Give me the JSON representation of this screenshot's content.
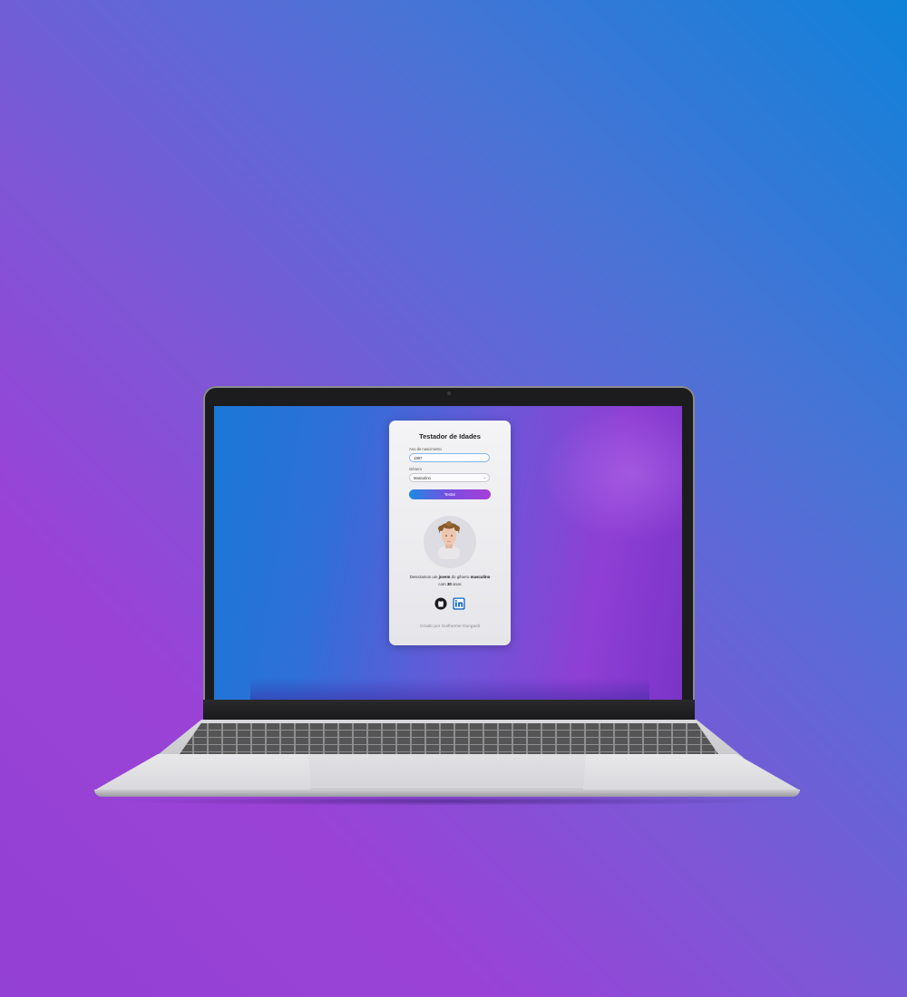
{
  "app": {
    "title": "Testador de Idades",
    "year_label": "Ano de nascimento",
    "year_value": "1997",
    "gender_label": "Gênero",
    "gender_value": "Masculino",
    "submit_label": "Testar",
    "result": {
      "prefix": "Detectamos um",
      "age_group": "jovem",
      "middle": "do gênero",
      "gender": "masculino",
      "line2_prefix": "com",
      "age": "30",
      "line2_suffix": "anos"
    },
    "icons": [
      "github-icon",
      "linkedin-icon"
    ],
    "credit": "Criado por Guilherme Dungueli"
  },
  "colors": {
    "button_gradient": [
      "#1d89e2",
      "#a63fd8"
    ],
    "input_border": "#84b7ea"
  }
}
